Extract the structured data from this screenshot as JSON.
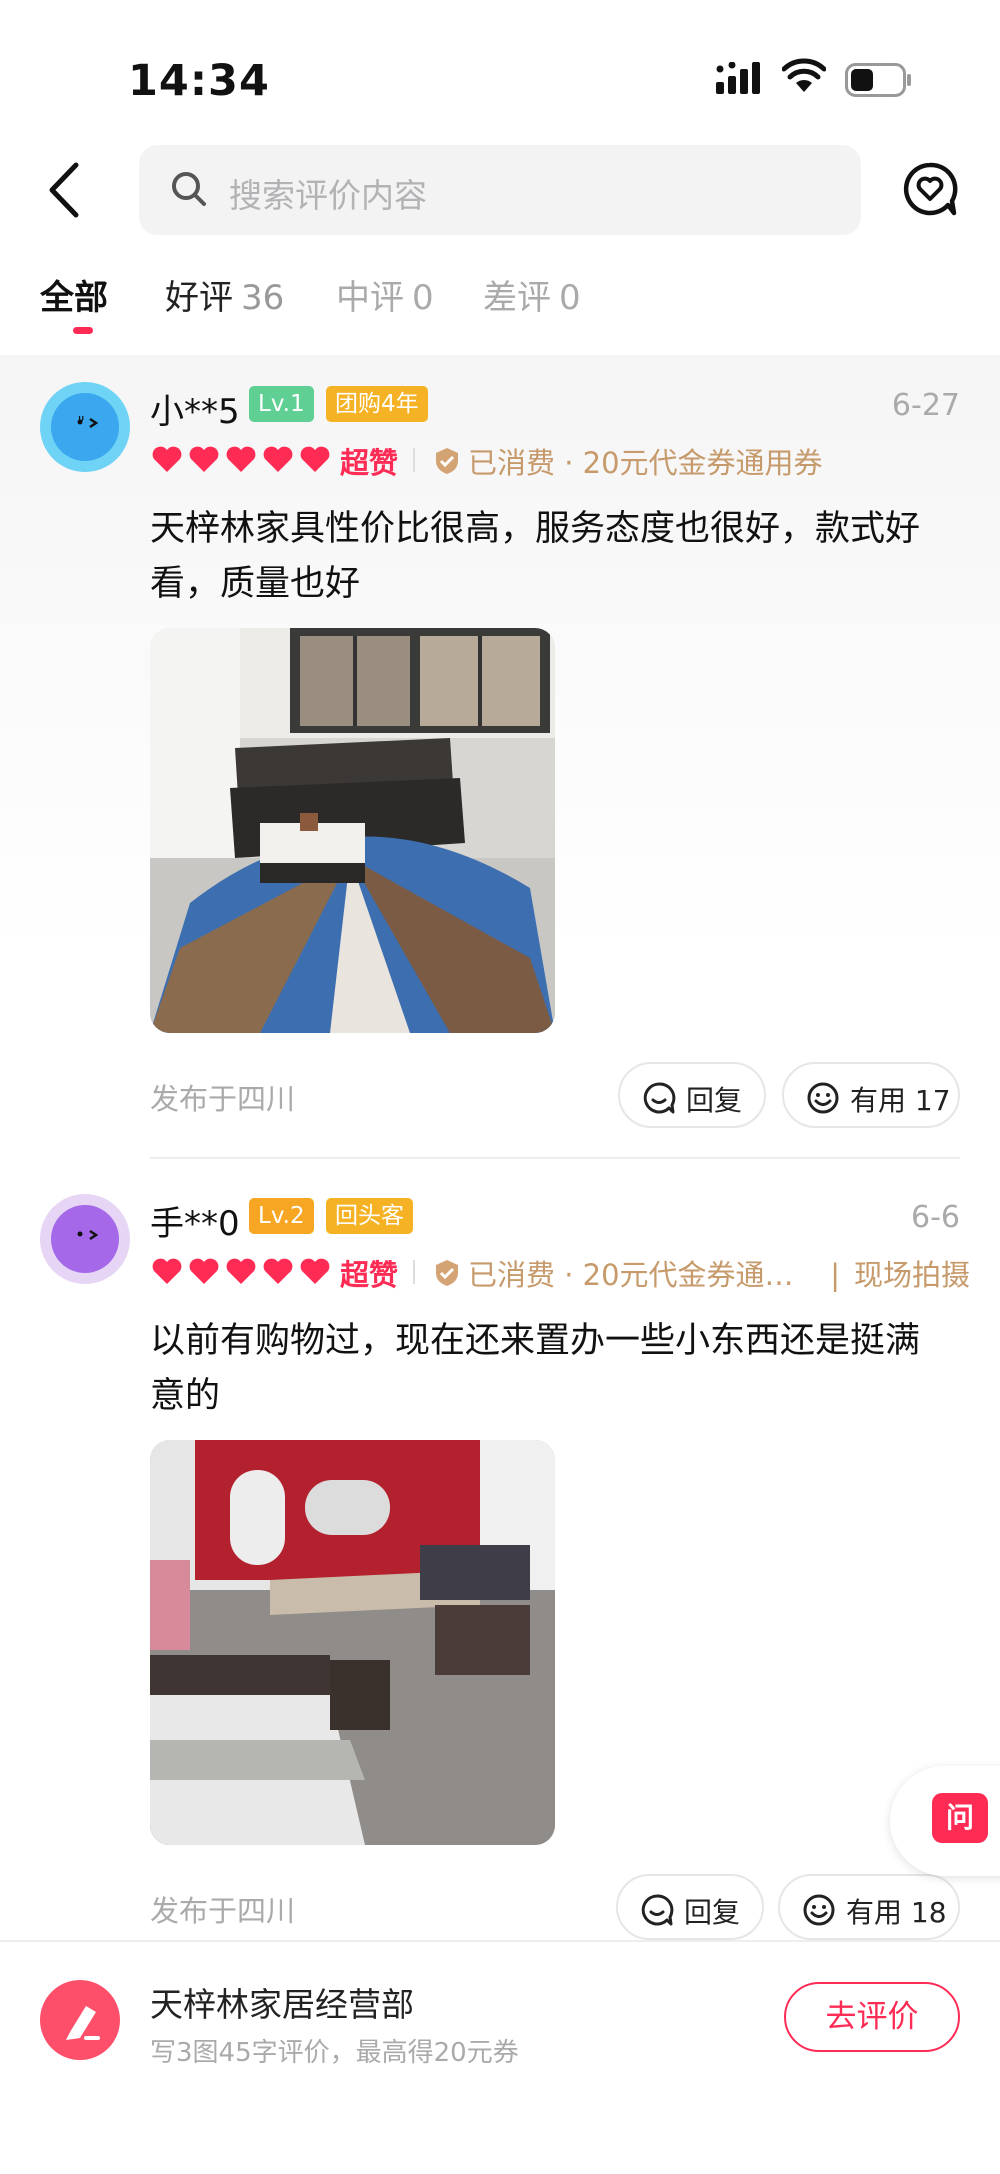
{
  "status_bar": {
    "time": "14:34"
  },
  "search": {
    "placeholder": "搜索评价内容"
  },
  "tabs": [
    {
      "label": "全部",
      "count": ""
    },
    {
      "label": "好评",
      "count": "36"
    },
    {
      "label": "中评",
      "count": "0"
    },
    {
      "label": "差评",
      "count": "0"
    }
  ],
  "reviews": [
    {
      "user": "小**5",
      "level": "Lv.1",
      "tag": "团购4年",
      "date": "6-27",
      "rating_label": "超赞",
      "consume": "已消费 · 20元代金券通用券",
      "onsite": "",
      "text": "天梓林家具性价比很高，服务态度也很好，款式好看，质量也好",
      "location": "发布于四川",
      "reply_label": "回复",
      "useful_label": "有用 17"
    },
    {
      "user": "手**0",
      "level": "Lv.2",
      "tag": "回头客",
      "date": "6-6",
      "rating_label": "超赞",
      "consume": "已消费 · 20元代金券通…",
      "onsite": "现场拍摄",
      "text": "以前有购物过，现在还来置办一些小东西还是挺满意的",
      "location": "发布于四川",
      "reply_label": "回复",
      "useful_label": "有用 18"
    }
  ],
  "float": {
    "ask_label": "问"
  },
  "bottom": {
    "shop_name": "天梓林家居经营部",
    "subtitle": "写3图45字评价，最高得20元券",
    "button": "去评价"
  },
  "colors": {
    "accent": "#fe2c55",
    "consume": "#c69a6b",
    "level1": "#5fcf94",
    "level2": "#f6a623",
    "tag": "#f5b224"
  }
}
